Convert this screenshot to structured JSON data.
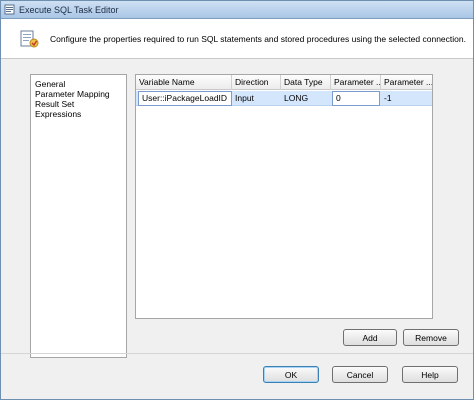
{
  "window": {
    "title": "Execute SQL Task Editor"
  },
  "header": {
    "description": "Configure the properties required to run SQL statements and stored procedures using the selected connection.",
    "icon": "sql-task-icon"
  },
  "nav": {
    "items": [
      {
        "label": "General"
      },
      {
        "label": "Parameter Mapping",
        "selected": true
      },
      {
        "label": "Result Set"
      },
      {
        "label": "Expressions"
      }
    ]
  },
  "grid": {
    "columns": [
      "Variable Name",
      "Direction",
      "Data Type",
      "Parameter ...",
      "Parameter ..."
    ],
    "rows": [
      {
        "variable_name": "User::iPackageLoadID",
        "direction": "Input",
        "data_type": "LONG",
        "parameter_name": "0",
        "parameter_size": "-1"
      }
    ]
  },
  "buttons": {
    "add": "Add",
    "remove": "Remove",
    "ok": "OK",
    "cancel": "Cancel",
    "help": "Help"
  },
  "colors": {
    "selected_row": "#d4e6fb",
    "title_bar": "#b9d2ee"
  }
}
